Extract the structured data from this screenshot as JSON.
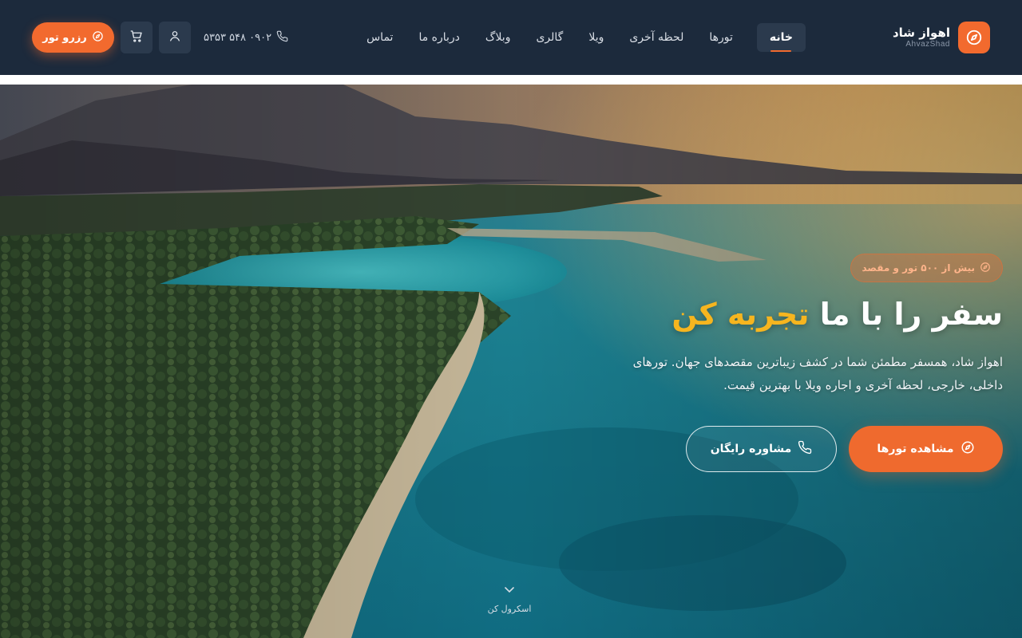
{
  "brand": {
    "name": "اهواز شاد",
    "sub": "AhvazShad",
    "logo_icon": "compass-icon",
    "accent": "#f26a2e"
  },
  "nav": {
    "items": [
      {
        "label": "خانه",
        "active": true
      },
      {
        "label": "تورها"
      },
      {
        "label": "لحظه آخری"
      },
      {
        "label": "ویلا"
      },
      {
        "label": "گالری"
      },
      {
        "label": "وبلاگ"
      },
      {
        "label": "درباره ما"
      },
      {
        "label": "تماس"
      }
    ]
  },
  "header_tools": {
    "phone": "۰۹۰۲ ۵۴۸ ۵۳۵۳",
    "book_label": "رزرو تور",
    "user_icon": "user-icon",
    "cart_icon": "cart-icon"
  },
  "hero": {
    "tag": "بیش از ۵۰۰ تور و مقصد",
    "title_main": "سفر را با ما",
    "title_accent": "تجربه کن",
    "accent_color": "#f6b51f",
    "lead": "اهواز شاد، همسفر مطمئن شما در کشف زیباترین مقصدهای جهان. تورهای داخلی، خارجی، لحظه آخری و اجاره ویلا با بهترین قیمت.",
    "primary_button": "مشاهده تورها",
    "secondary_button": "مشاوره رایگان",
    "scroll_hint": "اسکرول کن"
  }
}
